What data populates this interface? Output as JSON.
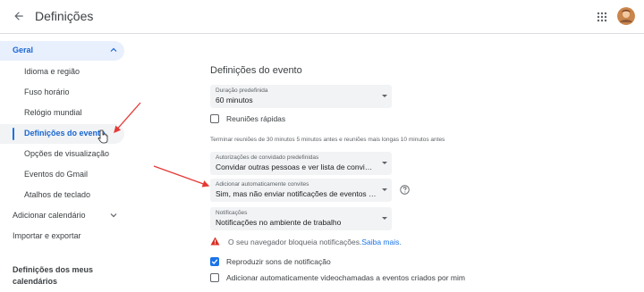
{
  "header": {
    "title": "Definições",
    "back_icon": "arrow-back-icon",
    "apps_icon": "apps-grid-icon",
    "avatar_icon": "account-avatar"
  },
  "sidebar": {
    "group": {
      "label": "Geral",
      "expanded": true
    },
    "subitems": [
      {
        "label": "Idioma e região",
        "active": false
      },
      {
        "label": "Fuso horário",
        "active": false
      },
      {
        "label": "Relógio mundial",
        "active": false
      },
      {
        "label": "Definições do evento",
        "active": true
      },
      {
        "label": "Opções de visualização",
        "active": false
      },
      {
        "label": "Eventos do Gmail",
        "active": false
      },
      {
        "label": "Atalhos de teclado",
        "active": false
      }
    ],
    "add_calendar": "Adicionar calendário",
    "import_export": "Importar e exportar",
    "my_calendars_title": "Definições dos meus calendários"
  },
  "main": {
    "heading": "Definições do evento",
    "duration": {
      "caption": "Duração predefinida",
      "value": "60 minutos"
    },
    "speedy_meetings": {
      "label": "Reuniões rápidas",
      "checked": false
    },
    "speedy_hint": "Terminar reuniões de 30 minutos 5 minutos antes e reuniões mais longas 10 minutos antes",
    "guest_permissions": {
      "caption": "Autorizações de convidado predefinidas",
      "value": "Convidar outras pessoas e ver lista de convidados"
    },
    "auto_add_invites": {
      "caption": "Adicionar automaticamente convites",
      "value": "Sim, mas não enviar notificações de eventos a nã..."
    },
    "notifications": {
      "caption": "Notificações",
      "value": "Notificações no ambiente de trabalho"
    },
    "warning": {
      "text": "O seu navegador bloqueia notificações.",
      "link": "Saiba mais."
    },
    "play_sounds": {
      "label": "Reproduzir sons de notificação",
      "checked": true
    },
    "auto_video": {
      "label": "Adicionar automaticamente videochamadas a eventos criados por mim",
      "checked": false
    }
  },
  "colors": {
    "accent": "#1a73e8",
    "active_bg": "#e8f0fe",
    "warning": "#d93025",
    "annotation_arrow": "#e53935"
  }
}
